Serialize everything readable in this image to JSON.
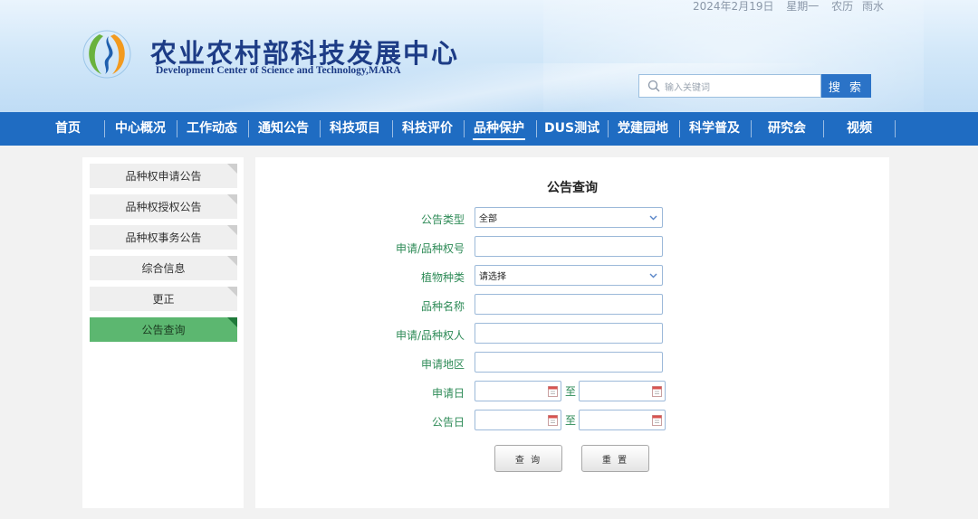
{
  "header": {
    "date": "2024年2月19日",
    "weekday": "星期一",
    "lunar": "农历",
    "solar_term": "雨水",
    "title_cn": "农业农村部科技发展中心",
    "title_en": "Development Center of Science and Technology,MARA"
  },
  "search": {
    "placeholder": "输入关键词",
    "button": "搜 索"
  },
  "nav": {
    "items": [
      "首页",
      "中心概况",
      "工作动态",
      "通知公告",
      "科技项目",
      "科技评价",
      "品种保护",
      "DUS测试",
      "党建园地",
      "科学普及",
      "研究会",
      "视频"
    ],
    "active": "品种保护"
  },
  "sidebar": {
    "items": [
      "品种权申请公告",
      "品种权授权公告",
      "品种权事务公告",
      "综合信息",
      "更正",
      "公告查询"
    ],
    "active": "公告查询"
  },
  "form": {
    "title": "公告查询",
    "type_label": "公告类型",
    "type_value": "全部",
    "app_no_label": "申请/品种权号",
    "plant_label": "植物种类",
    "plant_value": "请选择",
    "variety_label": "品种名称",
    "applicant_label": "申请/品种权人",
    "region_label": "申请地区",
    "apply_date_label": "申请日",
    "publish_date_label": "公告日",
    "to_label": "至",
    "query_button": "查 询",
    "reset_button": "重 置"
  },
  "colors": {
    "nav_bg": "#1f6cc2",
    "search_button": "#2b73c7",
    "sidebar_active": "#5cb770",
    "label_green": "#2e8b57",
    "title_blue": "#1d3c86"
  }
}
